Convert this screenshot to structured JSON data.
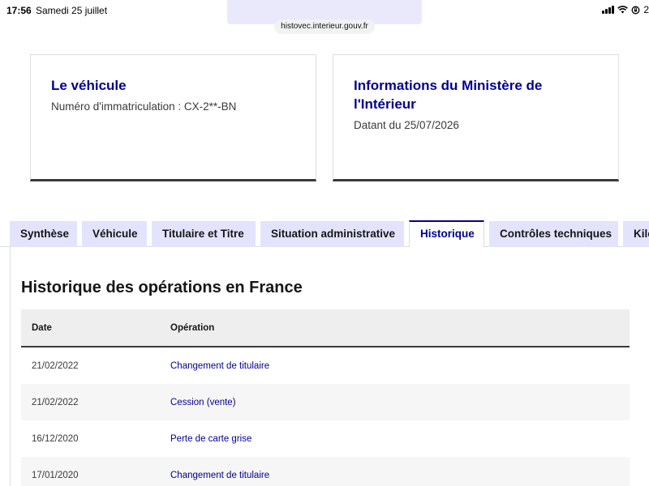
{
  "status_bar": {
    "time": "17:56",
    "date": "Samedi 25 juillet",
    "battery_text": "2"
  },
  "browser": {
    "url": "histovec.interieur.gouv.fr"
  },
  "cards": {
    "vehicle": {
      "title": "Le véhicule",
      "plate_line": "Numéro d'immatriculation : CX-2**-BN"
    },
    "ministry": {
      "title": "Informations du Ministère de l'Intérieur",
      "date_line": "Datant du 25/07/2026"
    }
  },
  "tabs": [
    {
      "label": "Synthèse"
    },
    {
      "label": "Véhicule"
    },
    {
      "label": "Titulaire et Titre"
    },
    {
      "label": "Situation administrative"
    },
    {
      "label": "Historique"
    },
    {
      "label": "Contrôles techniques"
    },
    {
      "label": "Kilométrage"
    }
  ],
  "active_tab": "Historique",
  "history": {
    "title": "Historique des opérations en France",
    "columns": {
      "date": "Date",
      "operation": "Opération"
    },
    "rows": [
      {
        "date": "21/02/2022",
        "operation": "Changement de titulaire"
      },
      {
        "date": "21/02/2022",
        "operation": "Cession (vente)"
      },
      {
        "date": "16/12/2020",
        "operation": "Perte de carte grise"
      },
      {
        "date": "17/01/2020",
        "operation": "Changement de titulaire"
      }
    ]
  },
  "colors": {
    "brand_blue": "#000091",
    "tab_bg": "#e3e3fd",
    "table_header_bg": "#eeeeee"
  }
}
